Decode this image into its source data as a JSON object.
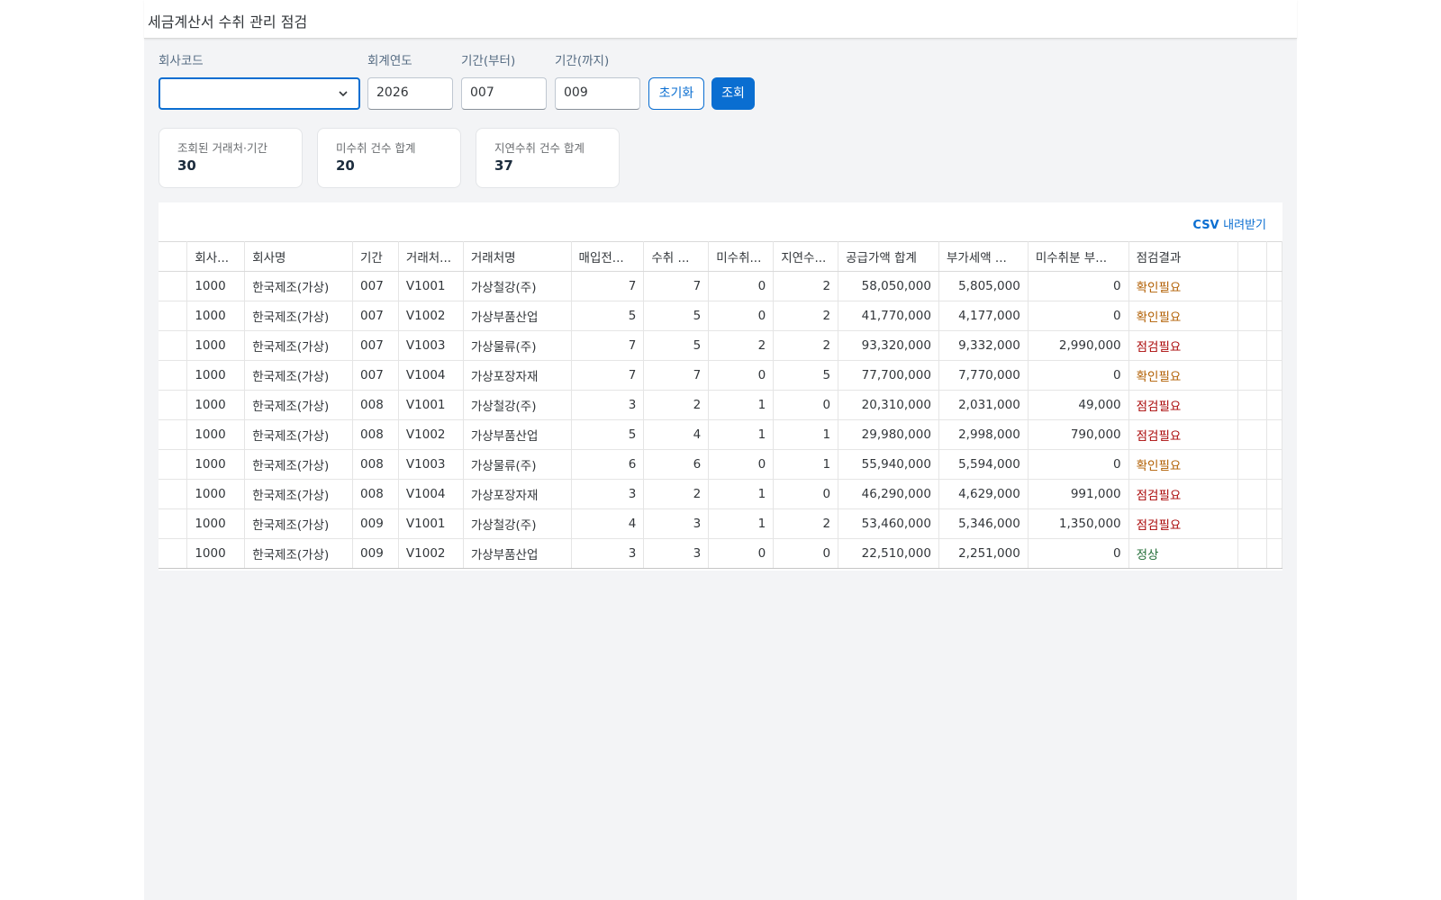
{
  "header": {
    "title": "세금계산서 수취 관리 점검"
  },
  "filters": {
    "company_code": {
      "label": "회사코드",
      "value": ""
    },
    "fiscal_year": {
      "label": "회계연도",
      "value": "2026"
    },
    "period_from": {
      "label": "기간(부터)",
      "value": "007"
    },
    "period_to": {
      "label": "기간(까지)",
      "value": "009"
    },
    "reset_label": "초기화",
    "search_label": "조회"
  },
  "summary": [
    {
      "label": "조회된 거래처·기간",
      "value": "30"
    },
    {
      "label": "미수취 건수 합계",
      "value": "20"
    },
    {
      "label": "지연수취 건수 합계",
      "value": "37"
    }
  ],
  "toolbar": {
    "csv_bold": "CSV",
    "csv_rest": "내려받기"
  },
  "table": {
    "columns": [
      "회사...",
      "회사명",
      "기간",
      "거래처...",
      "거래처명",
      "매입전...",
      "수취 ...",
      "미수취...",
      "지연수...",
      "공급가액 합계",
      "부가세액 ...",
      "미수취분 부...",
      "점검결과"
    ],
    "rows": [
      [
        "1000",
        "한국제조(가상)",
        "007",
        "V1001",
        "가상철강(주)",
        "7",
        "7",
        "0",
        "2",
        "58,050,000",
        "5,805,000",
        "0",
        "확인필요"
      ],
      [
        "1000",
        "한국제조(가상)",
        "007",
        "V1002",
        "가상부품산업",
        "5",
        "5",
        "0",
        "2",
        "41,770,000",
        "4,177,000",
        "0",
        "확인필요"
      ],
      [
        "1000",
        "한국제조(가상)",
        "007",
        "V1003",
        "가상물류(주)",
        "7",
        "5",
        "2",
        "2",
        "93,320,000",
        "9,332,000",
        "2,990,000",
        "점검필요"
      ],
      [
        "1000",
        "한국제조(가상)",
        "007",
        "V1004",
        "가상포장자재",
        "7",
        "7",
        "0",
        "5",
        "77,700,000",
        "7,770,000",
        "0",
        "확인필요"
      ],
      [
        "1000",
        "한국제조(가상)",
        "008",
        "V1001",
        "가상철강(주)",
        "3",
        "2",
        "1",
        "0",
        "20,310,000",
        "2,031,000",
        "49,000",
        "점검필요"
      ],
      [
        "1000",
        "한국제조(가상)",
        "008",
        "V1002",
        "가상부품산업",
        "5",
        "4",
        "1",
        "1",
        "29,980,000",
        "2,998,000",
        "790,000",
        "점검필요"
      ],
      [
        "1000",
        "한국제조(가상)",
        "008",
        "V1003",
        "가상물류(주)",
        "6",
        "6",
        "0",
        "1",
        "55,940,000",
        "5,594,000",
        "0",
        "확인필요"
      ],
      [
        "1000",
        "한국제조(가상)",
        "008",
        "V1004",
        "가상포장자재",
        "3",
        "2",
        "1",
        "0",
        "46,290,000",
        "4,629,000",
        "991,000",
        "점검필요"
      ],
      [
        "1000",
        "한국제조(가상)",
        "009",
        "V1001",
        "가상철강(주)",
        "4",
        "3",
        "1",
        "2",
        "53,460,000",
        "5,346,000",
        "1,350,000",
        "점검필요"
      ],
      [
        "1000",
        "한국제조(가상)",
        "009",
        "V1002",
        "가상부품산업",
        "3",
        "3",
        "0",
        "0",
        "22,510,000",
        "2,251,000",
        "0",
        "정상"
      ]
    ],
    "status_colors": {
      "확인필요": "#b15e00",
      "점검필요": "#aa0808",
      "정상": "#256f3a"
    }
  }
}
